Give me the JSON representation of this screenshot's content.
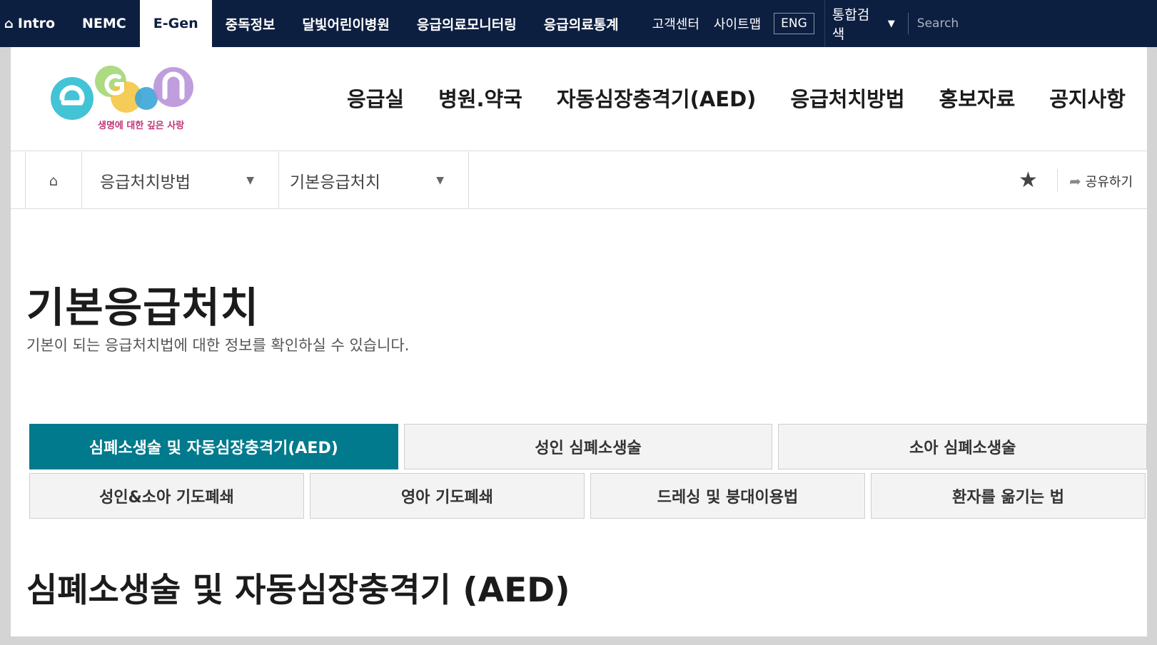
{
  "topbar": {
    "home_label": "Intro",
    "items": [
      {
        "label": "NEMC"
      },
      {
        "label": "E-Gen",
        "active": true
      },
      {
        "label": "중독정보"
      },
      {
        "label": "달빛어린이병원"
      },
      {
        "label": "응급의료모니터링"
      },
      {
        "label": "응급의료통계"
      }
    ],
    "util": [
      {
        "label": "고객센터"
      },
      {
        "label": "사이트맵"
      }
    ],
    "eng_label": "ENG",
    "search_scope": "통합검색",
    "search_placeholder": "Search"
  },
  "header": {
    "logo": {
      "wordmark": "E-Gen",
      "tagline": "생명에 대한 깊은 사랑"
    },
    "nav": [
      {
        "label": "응급실"
      },
      {
        "label": "병원.약국"
      },
      {
        "label": "자동심장충격기(AED)"
      },
      {
        "label": "응급처치방법"
      },
      {
        "label": "홍보자료"
      },
      {
        "label": "공지사항"
      }
    ]
  },
  "breadcrumb": {
    "level1": "응급처치방법",
    "level2": "기본응급처치",
    "share_label": "공유하기"
  },
  "page": {
    "title": "기본응급처치",
    "description": "기본이 되는 응급처치법에 대한 정보를 확인하실 수 있습니다."
  },
  "tabs_row1": [
    {
      "label": "심폐소생술 및 자동심장충격기(AED)",
      "active": true
    },
    {
      "label": "성인 심폐소생술"
    },
    {
      "label": "소아 심폐소생술"
    }
  ],
  "tabs_row2": [
    {
      "label": "성인&소아 기도폐쇄"
    },
    {
      "label": "영아 기도폐쇄"
    },
    {
      "label": "드레싱 및 붕대이용법"
    },
    {
      "label": "환자를 옮기는 법"
    }
  ],
  "section": {
    "title": "심폐소생술 및 자동심장충격기 (AED)"
  },
  "colors": {
    "topbar": "#0d1f40",
    "active_tab": "#007a8c"
  }
}
